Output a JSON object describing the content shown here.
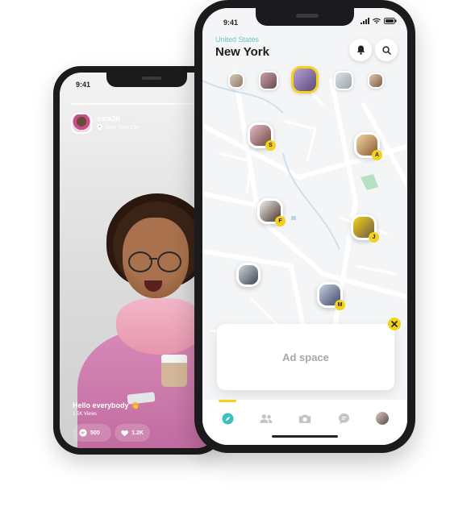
{
  "story_phone": {
    "time": "9:41",
    "progress": 0.7,
    "username": "sara3li",
    "age": "1h",
    "location": "New York City",
    "caption": "Hello everybody 👋",
    "views": "1.5K Views",
    "comments_count": "500",
    "likes_count": "1.2K"
  },
  "map_phone": {
    "time": "9:41",
    "country": "United States",
    "city": "New York",
    "ad_label": "Ad space",
    "markers": [
      {
        "badge": "S"
      },
      {
        "badge": "A"
      },
      {
        "badge": "F"
      },
      {
        "badge": "J"
      },
      {
        "badge": "M"
      }
    ],
    "tabs": [
      "compass-icon",
      "people-icon",
      "camera-icon",
      "chat-icon",
      "profile-icon"
    ]
  },
  "colors": {
    "accent_teal": "#3fbfbf",
    "accent_yellow": "#f4d21c",
    "phone_body": "#1b1b1d"
  }
}
